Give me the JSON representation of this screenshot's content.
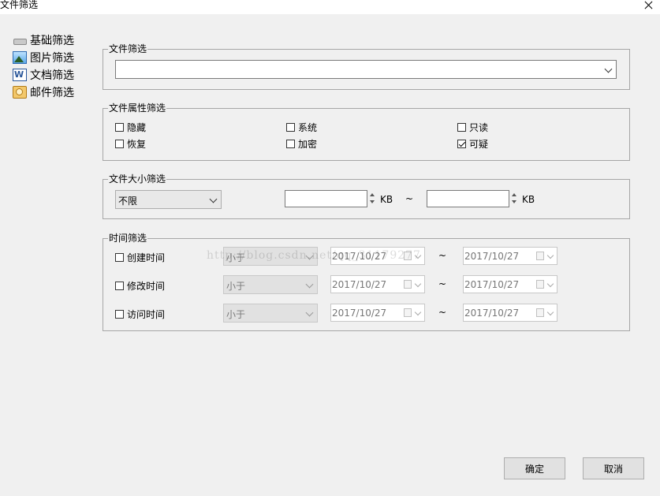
{
  "window": {
    "title": "文件筛选"
  },
  "nav": {
    "items": [
      {
        "label": "基础筛选",
        "icon": "drive-icon"
      },
      {
        "label": "图片筛选",
        "icon": "image-icon"
      },
      {
        "label": "文档筛选",
        "icon": "word-icon"
      },
      {
        "label": "邮件筛选",
        "icon": "mail-icon"
      }
    ]
  },
  "file_filter": {
    "legend": "文件筛选",
    "value": ""
  },
  "attr_filter": {
    "legend": "文件属性筛选",
    "options": [
      {
        "label": "隐藏",
        "checked": false
      },
      {
        "label": "系统",
        "checked": false
      },
      {
        "label": "只读",
        "checked": false
      },
      {
        "label": "恢复",
        "checked": false
      },
      {
        "label": "加密",
        "checked": false
      },
      {
        "label": "可疑",
        "checked": true
      }
    ]
  },
  "size_filter": {
    "legend": "文件大小筛选",
    "mode": "不限",
    "min_value": "",
    "max_value": "",
    "unit": "KB",
    "separator": "~"
  },
  "time_filter": {
    "legend": "时间筛选",
    "rows": [
      {
        "label": "创建时间",
        "checked": false,
        "compare": "小于",
        "from": "2017/10/27",
        "to": "2017/10/27"
      },
      {
        "label": "修改时间",
        "checked": false,
        "compare": "小于",
        "from": "2017/10/27",
        "to": "2017/10/27"
      },
      {
        "label": "访问时间",
        "checked": false,
        "compare": "小于",
        "from": "2017/10/27",
        "to": "2017/10/27"
      }
    ],
    "separator": "~"
  },
  "watermark": "http://blog.csdn.net/qq_31179277",
  "buttons": {
    "ok": "确定",
    "cancel": "取消"
  }
}
